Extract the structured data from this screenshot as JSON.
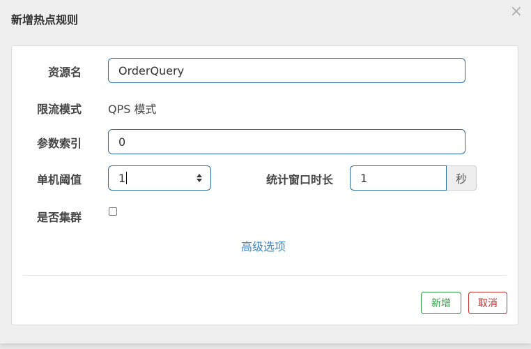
{
  "dialog": {
    "title": "新增热点规则",
    "close_symbol": "×"
  },
  "form": {
    "resource_name": {
      "label": "资源名",
      "value": "OrderQuery"
    },
    "limit_mode": {
      "label": "限流模式",
      "value": "QPS 模式"
    },
    "param_index": {
      "label": "参数索引",
      "value": "0"
    },
    "threshold": {
      "label": "单机阈值",
      "value": "1"
    },
    "window": {
      "label": "统计窗口时长",
      "value": "1",
      "unit": "秒"
    },
    "cluster": {
      "label": "是否集群",
      "checked": false
    },
    "advanced_link": "高级选项"
  },
  "buttons": {
    "add": "新增",
    "cancel": "取消"
  },
  "colors": {
    "input_border": "#2c6da3",
    "link": "#3a87c8",
    "add_button": "#2f9e44",
    "cancel_button": "#c9302c"
  }
}
